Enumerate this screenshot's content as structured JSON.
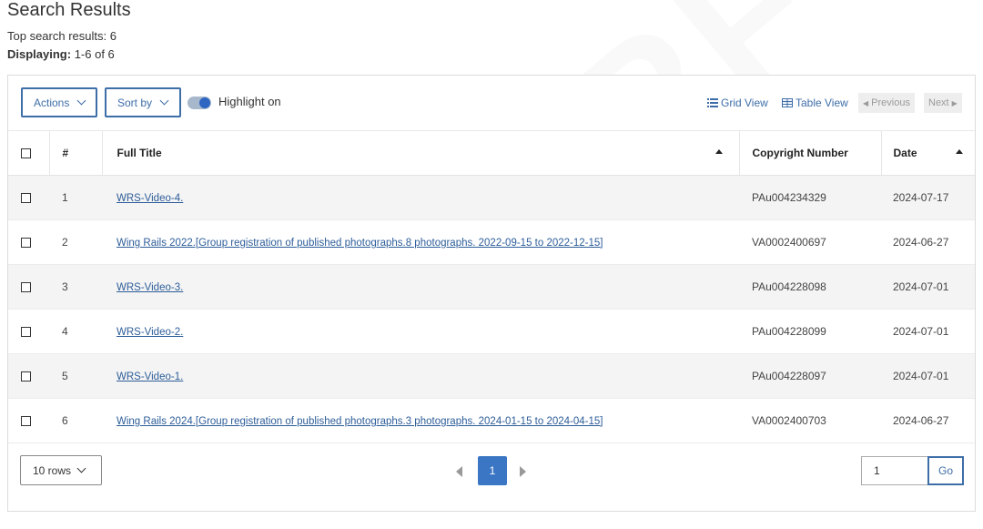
{
  "header": {
    "title": "Search Results",
    "top_results_label": "Top search results:",
    "top_results_count": "6",
    "displaying_label": "Displaying:",
    "displaying_value": "1-6 of 6"
  },
  "toolbar": {
    "actions_label": "Actions",
    "sort_label": "Sort by",
    "highlight_label": "Highlight on",
    "highlight_on": true,
    "grid_view_label": "Grid View",
    "table_view_label": "Table View",
    "previous_label": "Previous",
    "next_label": "Next"
  },
  "table": {
    "columns": {
      "number": "#",
      "title": "Full Title",
      "copyright": "Copyright Number",
      "date": "Date"
    },
    "rows": [
      {
        "num": "1",
        "title": "WRS-Video-4.",
        "copyright": "PAu004234329",
        "date": "2024-07-17"
      },
      {
        "num": "2",
        "title": "Wing Rails 2022.[Group registration of published photographs.8 photographs. 2022-09-15 to 2022-12-15]",
        "copyright": "VA0002400697",
        "date": "2024-06-27"
      },
      {
        "num": "3",
        "title": "WRS-Video-3.",
        "copyright": "PAu004228098",
        "date": "2024-07-01"
      },
      {
        "num": "4",
        "title": "WRS-Video-2.",
        "copyright": "PAu004228099",
        "date": "2024-07-01"
      },
      {
        "num": "5",
        "title": "WRS-Video-1.",
        "copyright": "PAu004228097",
        "date": "2024-07-01"
      },
      {
        "num": "6",
        "title": "Wing Rails 2024.[Group registration of published photographs.3 photographs. 2024-01-15 to 2024-04-15]",
        "copyright": "VA0002400703",
        "date": "2024-06-27"
      }
    ]
  },
  "footer": {
    "rows_per_page": "10 rows",
    "current_page": "1",
    "goto_value": "1",
    "go_label": "Go"
  },
  "watermark": "123RF",
  "colors": {
    "accent": "#3e6ea8",
    "link": "#2d5d99",
    "current_page": "#3a76c4",
    "row_stripe": "#f4f4f4"
  }
}
